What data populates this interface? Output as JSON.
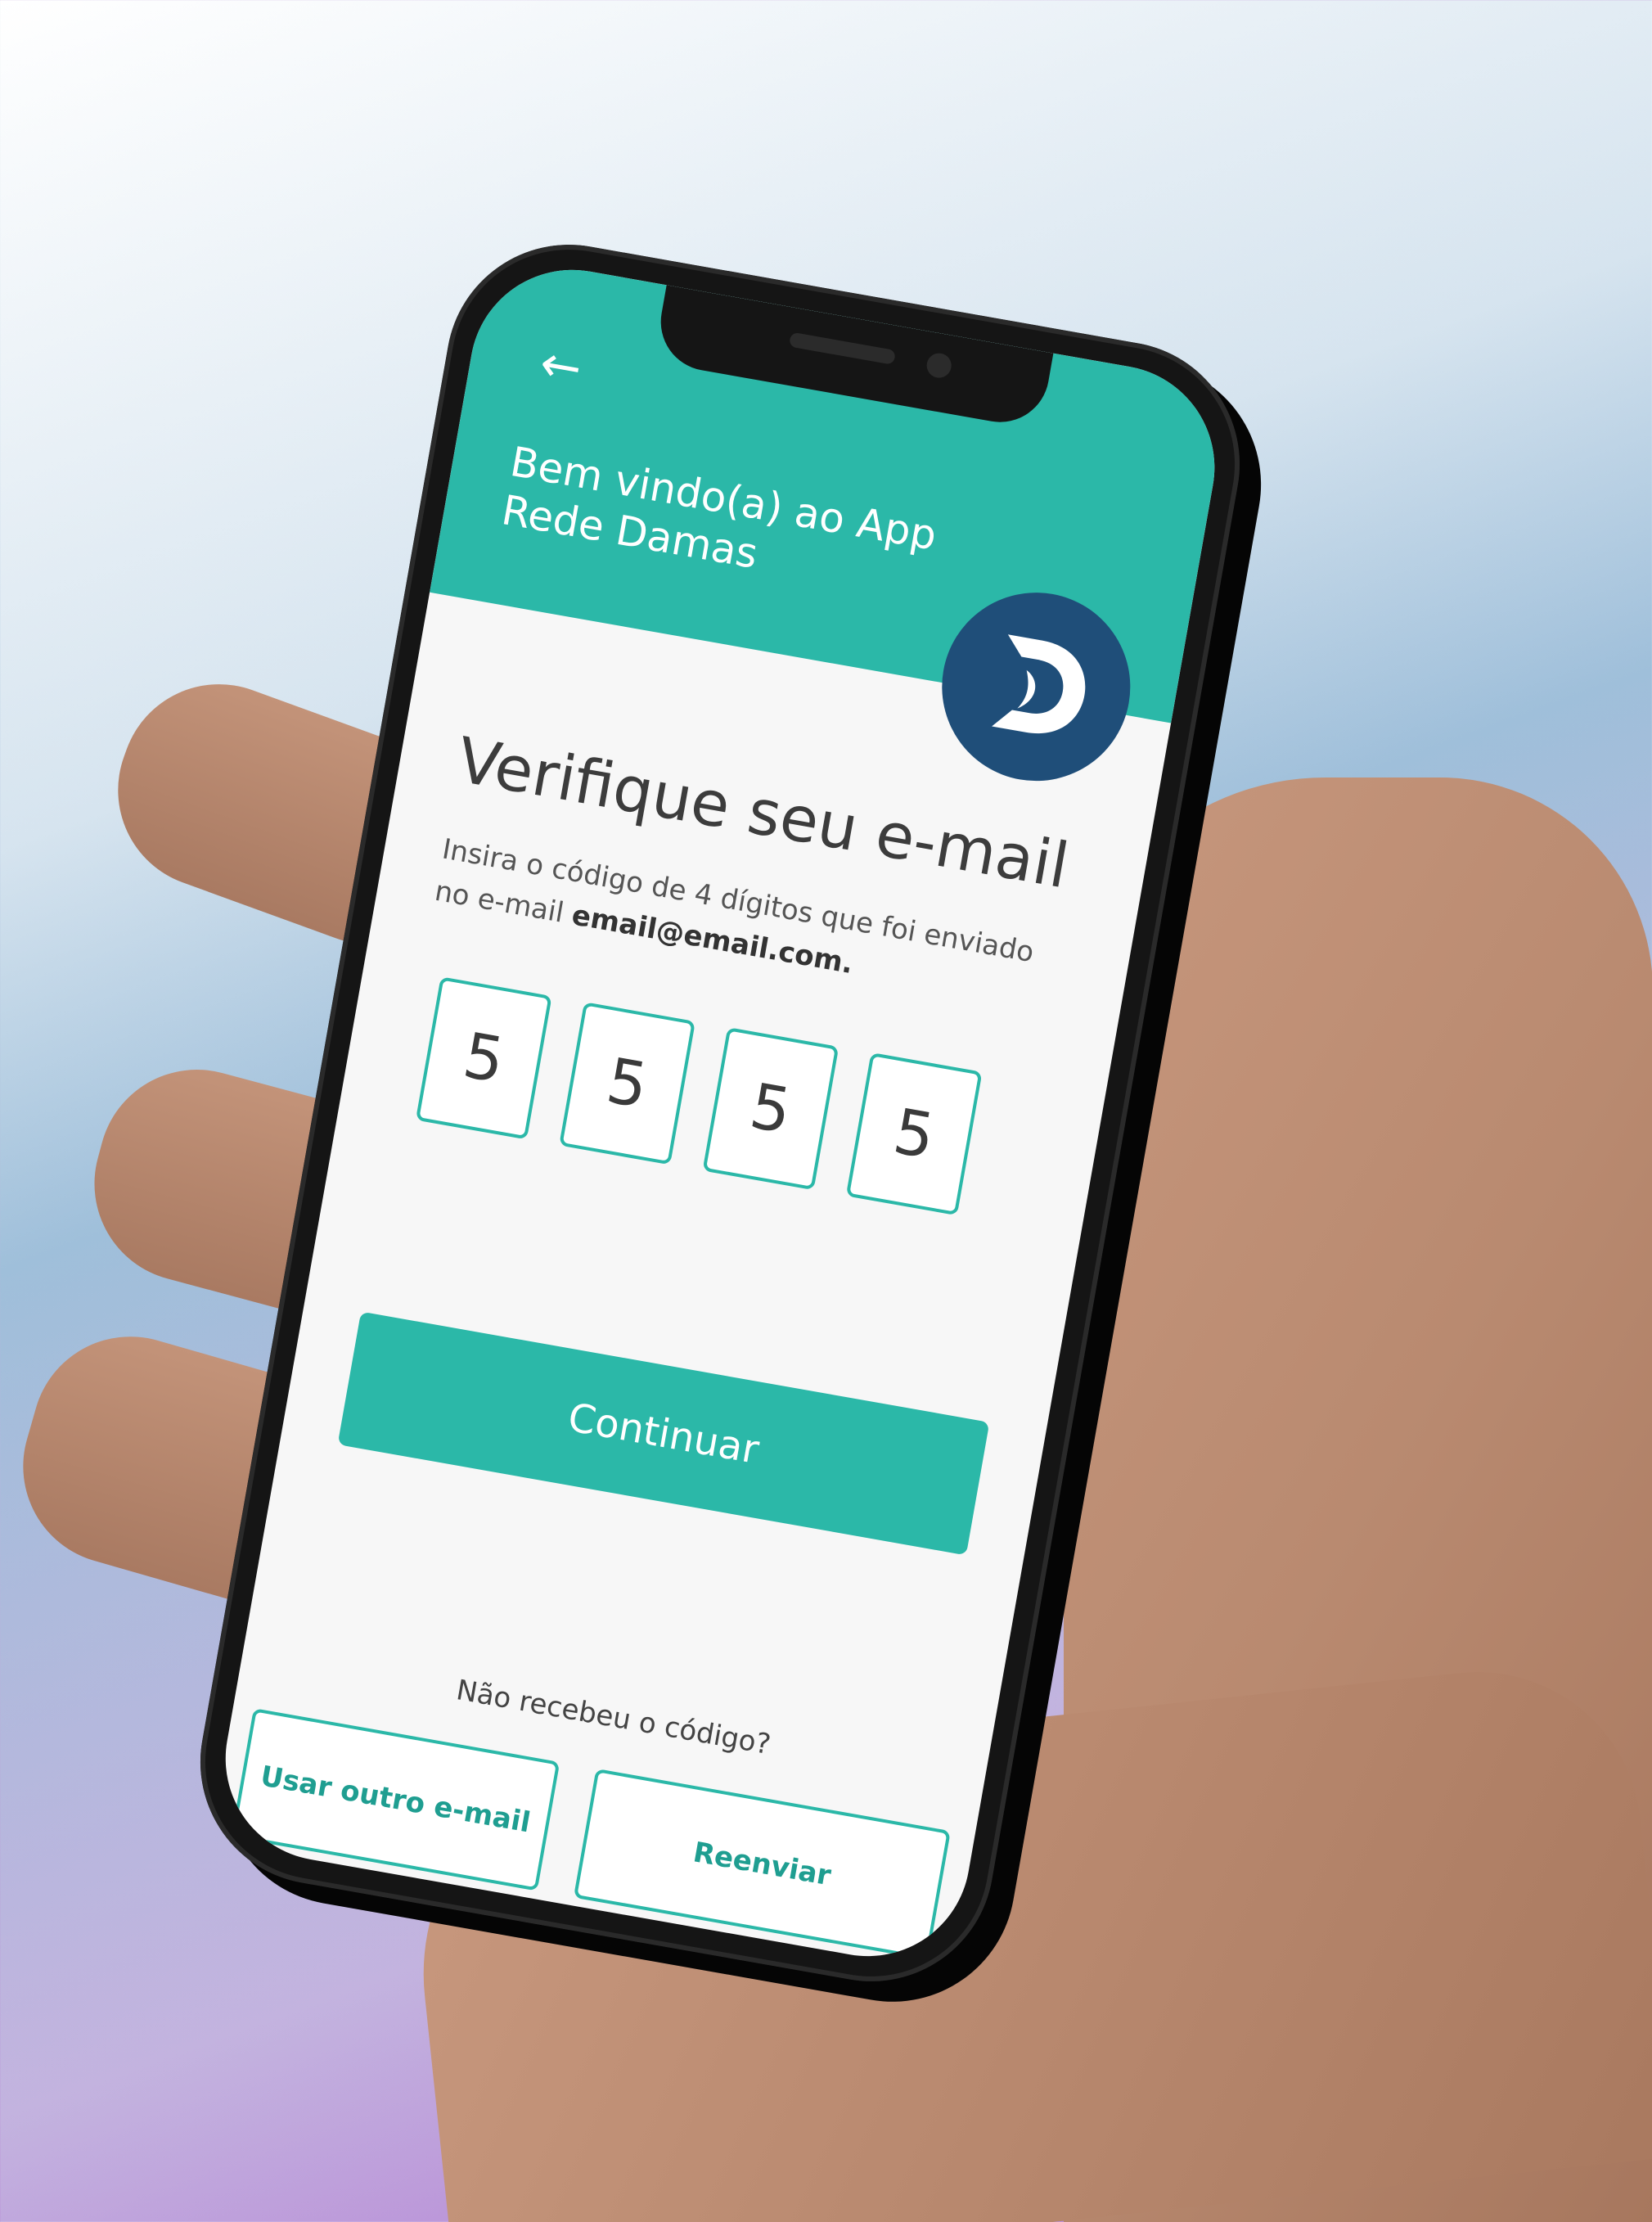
{
  "header": {
    "back_icon": "←",
    "welcome_text": "Bem vindo(a) ao App Rede Damas"
  },
  "main": {
    "title": "Verifique seu e-mail",
    "subtitle_prefix": "Insira o código de 4 dígitos que foi enviado no e-mail ",
    "email": "email@email.com.",
    "code": [
      "5",
      "5",
      "5",
      "5"
    ],
    "continue_label": "Continuar"
  },
  "footer": {
    "question": "Não recebeu o código?",
    "use_other_email_label": "Usar outro e-mail",
    "resend_label": "Reenviar"
  },
  "colors": {
    "accent": "#2bb8a8",
    "logo_bg": "#1f4e79"
  }
}
